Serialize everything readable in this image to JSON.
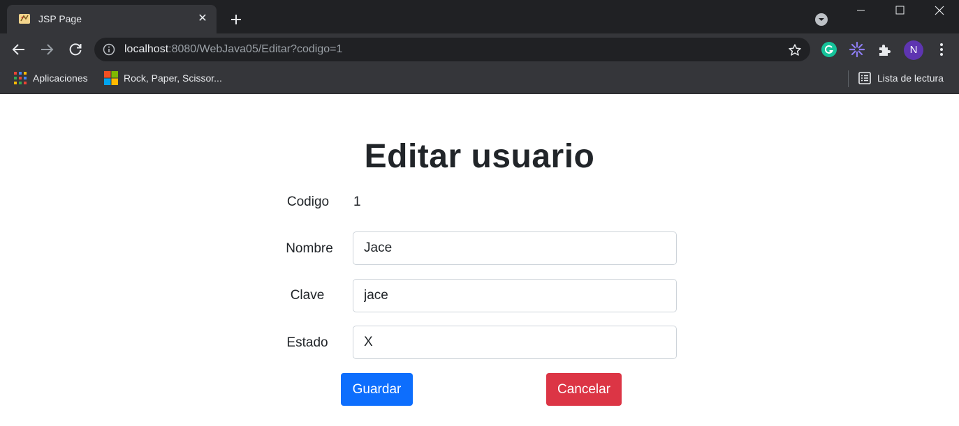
{
  "browser": {
    "tab": {
      "title": "JSP Page",
      "close_glyph": "✕"
    },
    "new_tab_icon": "plus-icon",
    "address_bar": {
      "host": "localhost",
      "rest": ":8080/WebJava05/Editar?codigo=1"
    },
    "profile_initial": "N",
    "profile_color": "#5e35b1",
    "bookmarks": [
      {
        "label": "Aplicaciones",
        "icon": "apps-grid-icon"
      },
      {
        "label": "Rock, Paper, Scissor...",
        "icon": "microsoft-logo-icon"
      }
    ],
    "reading_list": {
      "label": "Lista de lectura",
      "icon": "reading-list-icon"
    }
  },
  "page": {
    "title": "Editar usuario",
    "form": {
      "codigo": {
        "label": "Codigo",
        "value": "1"
      },
      "nombre": {
        "label": "Nombre",
        "value": "Jace"
      },
      "clave": {
        "label": "Clave",
        "value": "jace"
      },
      "estado": {
        "label": "Estado",
        "value": "X"
      }
    },
    "buttons": {
      "save": {
        "label": "Guardar",
        "color": "#0d6efd"
      },
      "cancel": {
        "label": "Cancelar",
        "color": "#dc3545"
      }
    }
  }
}
